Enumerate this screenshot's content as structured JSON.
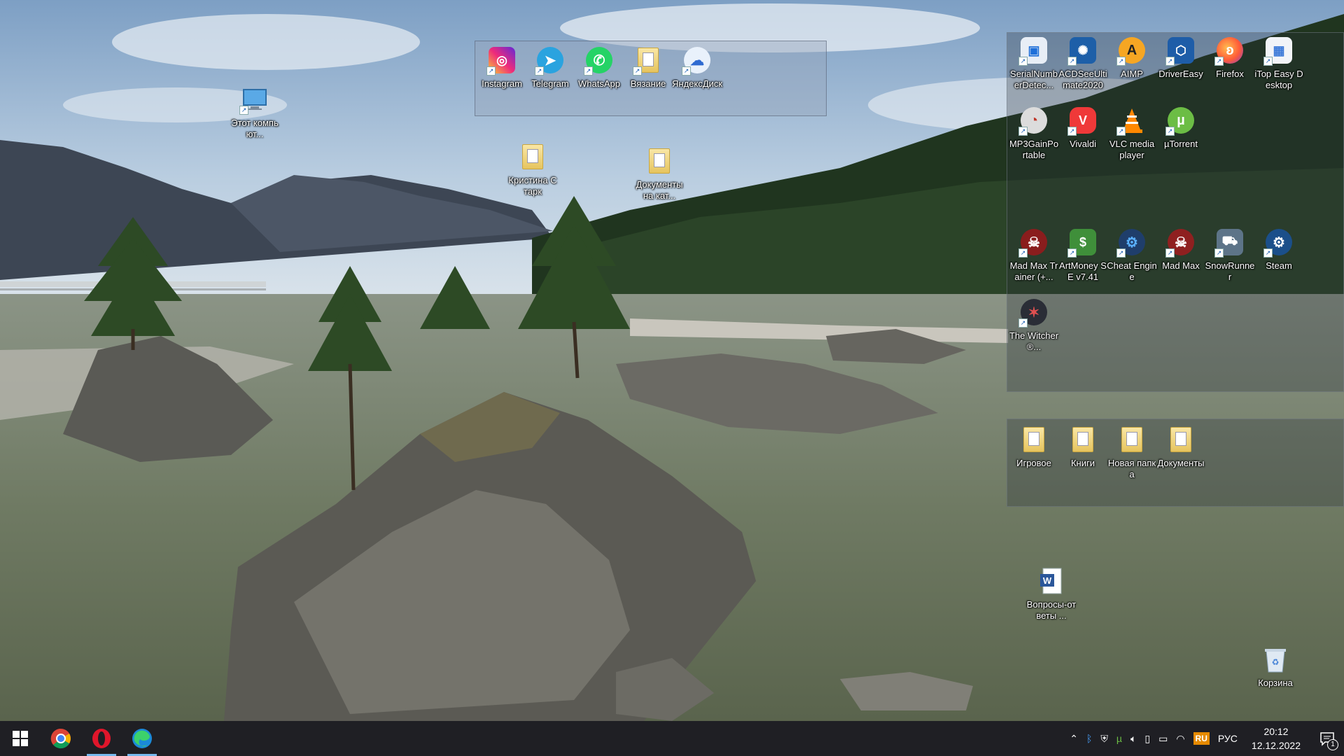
{
  "desktop": {
    "this_pc": {
      "label": "Этот компьют..."
    },
    "top_fence_items": [
      {
        "label": "Instagram",
        "icon": "instagram-icon"
      },
      {
        "label": "Telegram",
        "icon": "telegram-icon"
      },
      {
        "label": "WhatsApp",
        "icon": "whatsapp-icon"
      },
      {
        "label": "Вязание",
        "icon": "folder-icon"
      },
      {
        "label": "ЯндексДиск",
        "icon": "yandex-disk-icon"
      }
    ],
    "loose_folders": [
      {
        "label": "Кристина Старк",
        "icon": "folder-icon"
      },
      {
        "label": "Документы на кат...",
        "icon": "folder-icon"
      }
    ],
    "apps_fence_items": [
      {
        "label": "SerialNumberDetec...",
        "icon": "serialnumber-icon"
      },
      {
        "label": "ACDSeeUltimate2020",
        "icon": "acdsee-icon"
      },
      {
        "label": "AIMP",
        "icon": "aimp-icon"
      },
      {
        "label": "DriverEasy",
        "icon": "drivereasy-icon"
      },
      {
        "label": "Firefox",
        "icon": "firefox-icon"
      },
      {
        "label": "iTop Easy Desktop",
        "icon": "itop-icon"
      },
      {
        "label": "MP3GainPortable",
        "icon": "mp3gain-icon"
      },
      {
        "label": "Vivaldi",
        "icon": "vivaldi-icon"
      },
      {
        "label": "VLC media player",
        "icon": "vlc-icon"
      },
      {
        "label": "µTorrent",
        "icon": "utorrent-icon"
      }
    ],
    "games_fence_items": [
      {
        "label": "Mad Max Trainer (+...",
        "icon": "madmax-trainer-icon"
      },
      {
        "label": "ArtMoney SE v7.41",
        "icon": "artmoney-icon"
      },
      {
        "label": "Cheat Engine",
        "icon": "cheat-engine-icon"
      },
      {
        "label": "Mad Max",
        "icon": "madmax-icon"
      },
      {
        "label": "SnowRunner",
        "icon": "snowrunner-icon"
      },
      {
        "label": "Steam",
        "icon": "steam-icon"
      },
      {
        "label": "The Witcher®...",
        "icon": "witcher-icon"
      }
    ],
    "folders_fence_items": [
      {
        "label": "Игровое",
        "icon": "folder-icon"
      },
      {
        "label": "Книги",
        "icon": "folder-icon"
      },
      {
        "label": "Новая папка",
        "icon": "folder-icon"
      },
      {
        "label": "Документы",
        "icon": "folder-icon"
      }
    ],
    "word_doc": {
      "label": "Вопросы-ответы ...",
      "icon": "word-document-icon"
    },
    "recycle_bin": {
      "label": "Корзина",
      "icon": "recycle-bin-icon"
    }
  },
  "taskbar": {
    "pinned": [
      {
        "name": "start-button",
        "icon": "windows-icon"
      },
      {
        "name": "chrome",
        "icon": "chrome-icon"
      },
      {
        "name": "opera",
        "icon": "opera-icon",
        "active": true
      },
      {
        "name": "edge",
        "icon": "edge-icon",
        "active": true
      }
    ],
    "tray": {
      "language_badge": "RU",
      "input_language": "РУС",
      "time": "20:12",
      "date": "12.12.2022",
      "notifications_count": "1"
    }
  },
  "colors": {
    "taskbar_bg": "#1f1f24",
    "active_indicator": "#76b9ed",
    "fence_bg": "rgba(150,165,185,0.42)"
  }
}
